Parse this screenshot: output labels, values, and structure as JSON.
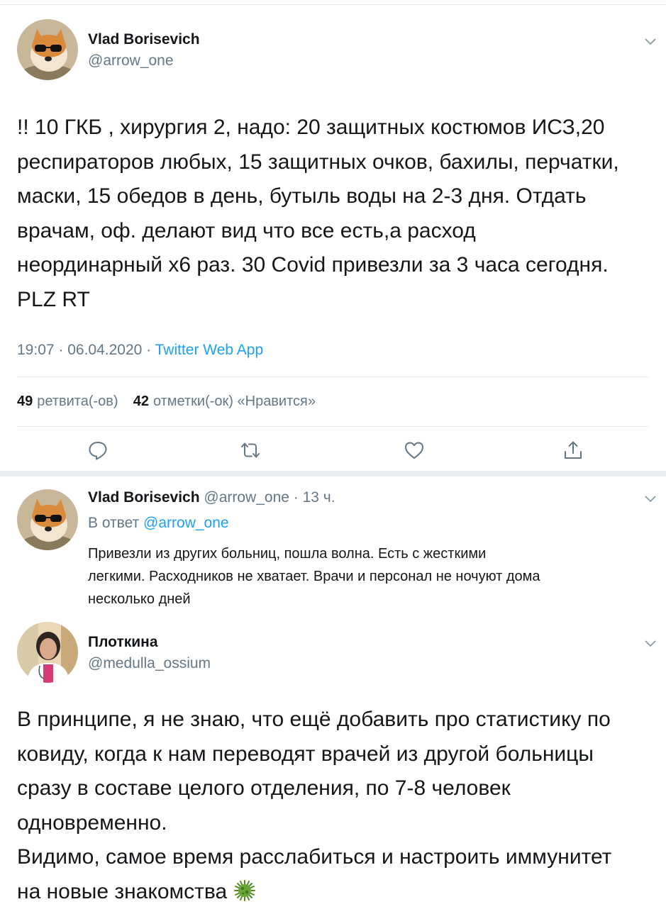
{
  "tweet1": {
    "name": "Vlad Borisevich",
    "handle": "@arrow_one",
    "lines": [
      "!! 10 ГКБ , хирургия 2, надо: 20 защитных костюмов ИСЗ,20",
      "респираторов любых, 15 защитных очков, бахилы, перчатки,",
      "маски, 15 обедов в день, бутыль воды на 2-3 дня. Отдать",
      "врачам, оф. делают вид что все есть,а расход",
      "неординарный x6 раз. 30 Covid привезли за 3 часа сегодня.",
      "PLZ RT"
    ],
    "time": "19:07 · 06.04.2020 · ",
    "source": "Twitter Web App",
    "retweets_count": "49",
    "retweets_label": "ретвита(-ов)",
    "likes_count": "42",
    "likes_label": "отметки(-ок) «Нравится»"
  },
  "reply": {
    "name": "Vlad Borisevich",
    "handle_time": " @arrow_one · 13 ч.",
    "reply_prefix": "В ответ ",
    "reply_mention": "@arrow_one",
    "lines": [
      "Привезли из других больниц, пошла волна. Есть с жесткими",
      "легкими. Расходников не хватает. Врачи и персонал не ночуют дома",
      "несколько дней"
    ]
  },
  "tweet2": {
    "name": "Плоткина",
    "handle": "@medulla_ossium",
    "lines": [
      "В принципе, я не знаю, что ещё добавить про статистику по",
      "ковиду, когда к нам переводят врачей из другой больницы",
      "сразу в составе целого отделения, по 7-8 человек",
      "одновременно.",
      "Видимо, самое время расслабиться и настроить иммунитет",
      "на новые знакомства"
    ]
  },
  "colors": {
    "text": "#14171a",
    "secondary": "#657786",
    "accent": "#1da1f2",
    "divider": "#e6ecf0",
    "virus": "#6aa437"
  },
  "icons": {
    "reply": "reply-icon",
    "retweet": "retweet-icon",
    "like": "like-icon",
    "share": "share-icon",
    "chevron": "chevron-down-icon",
    "virus": "microbe-emoji-icon"
  }
}
